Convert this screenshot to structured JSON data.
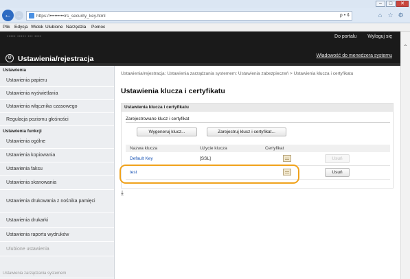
{
  "browser": {
    "address": "https://•••••••••/rs_security_key.html",
    "address_tools": "ρ • ¢",
    "menu": [
      "Plik",
      "Edycja",
      "Widok",
      "Ulubione",
      "Narzędzia",
      "Pomoc"
    ],
    "window_controls": [
      "–",
      "□",
      "✕"
    ]
  },
  "header": {
    "device_blur": "••••• ••••• ••• ••••",
    "to_portal": "Do portalu",
    "logout": "Wyloguj się",
    "title": "Ustawienia/rejestracja",
    "manager_mode": "Władowość do menedzera systemu"
  },
  "sidebar": {
    "group1": "Ustawienia",
    "items1": [
      "Ustawienia papieru",
      "Ustawienia wyświetlania",
      "Ustawienia włącznika czasowego",
      "Regulacja poziomu głośności"
    ],
    "group2": "Ustawienia funkcji",
    "items2": [
      "Ustawienia ogólne",
      "Ustawienia kopiowania",
      "Ustawienia faksu",
      "Ustawienia skanowania",
      "Ustawienia drukowania z nośnika pamięci",
      "Ustawienia drukarki",
      "Ustawienia raportu wydruków",
      "Ulubione ustawienia"
    ],
    "group3": "Ustawienia zarządzania systemem"
  },
  "main": {
    "breadcrumb": "Ustawienia/rejestracja: Ustawienia zarządzania systemem: Ustawienia zabezpieczeń > Ustawienia klucza i certyfikatu",
    "title": "Ustawienia klucza i certyfikatu",
    "panel_title": "Ustawienia klucza i certyfikatu",
    "section_label": "Zarejestrowano klucz i certyfikat",
    "btn_generate": "Wygeneruj klucz...",
    "btn_register": "Zarejestruj klucz i certyfikat...",
    "columns": [
      "Nazwa klucza",
      "Użycie klucza",
      "Certyfikat"
    ],
    "rows": [
      {
        "name": "Default Key",
        "usage": "[SSL]",
        "delete": "Usuń"
      },
      {
        "name": "test",
        "usage": "",
        "delete": "Usuń"
      }
    ]
  }
}
